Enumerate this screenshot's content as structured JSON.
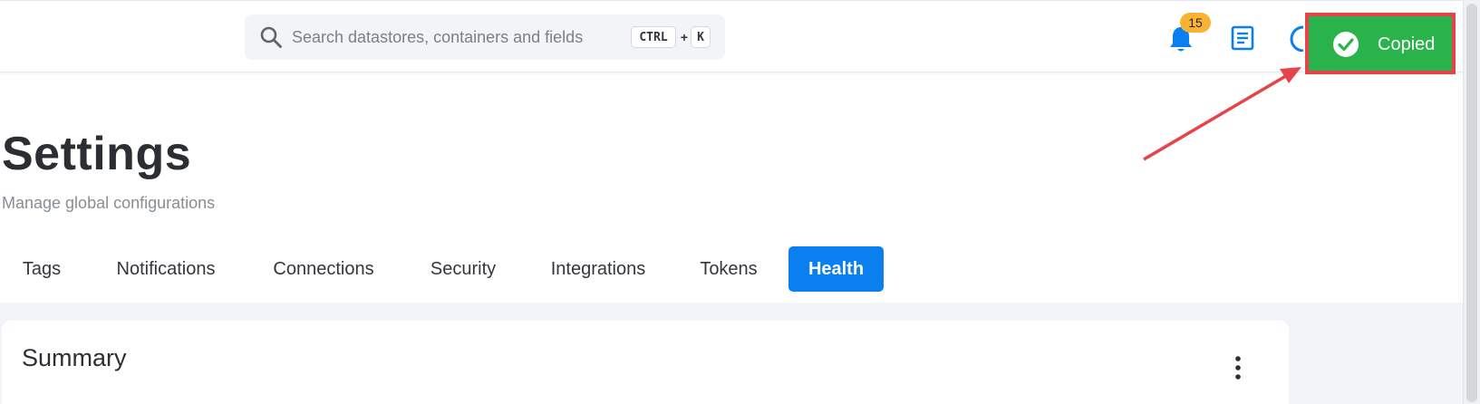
{
  "search": {
    "placeholder": "Search datastores, containers and fields",
    "shortcut_ctrl": "CTRL",
    "shortcut_plus": "+",
    "shortcut_key": "K"
  },
  "header": {
    "notification_count": "15",
    "icons": [
      "bell-icon",
      "document-icon",
      "partial-icon"
    ]
  },
  "toast": {
    "label": "Copied",
    "color": "#2ab24b",
    "highlight_border": "#e5454a"
  },
  "page": {
    "title": "Settings",
    "subtitle": "Manage global configurations"
  },
  "tabs": [
    {
      "label": "Tags"
    },
    {
      "label": "Notifications"
    },
    {
      "label": "Connections"
    },
    {
      "label": "Security"
    },
    {
      "label": "Integrations"
    },
    {
      "label": "Tokens"
    },
    {
      "label": "Health",
      "active": true
    }
  ],
  "summary": {
    "title": "Summary"
  },
  "colors": {
    "accent": "#0a7ff0",
    "badge": "#f9b234",
    "annotation": "#e5454a"
  }
}
